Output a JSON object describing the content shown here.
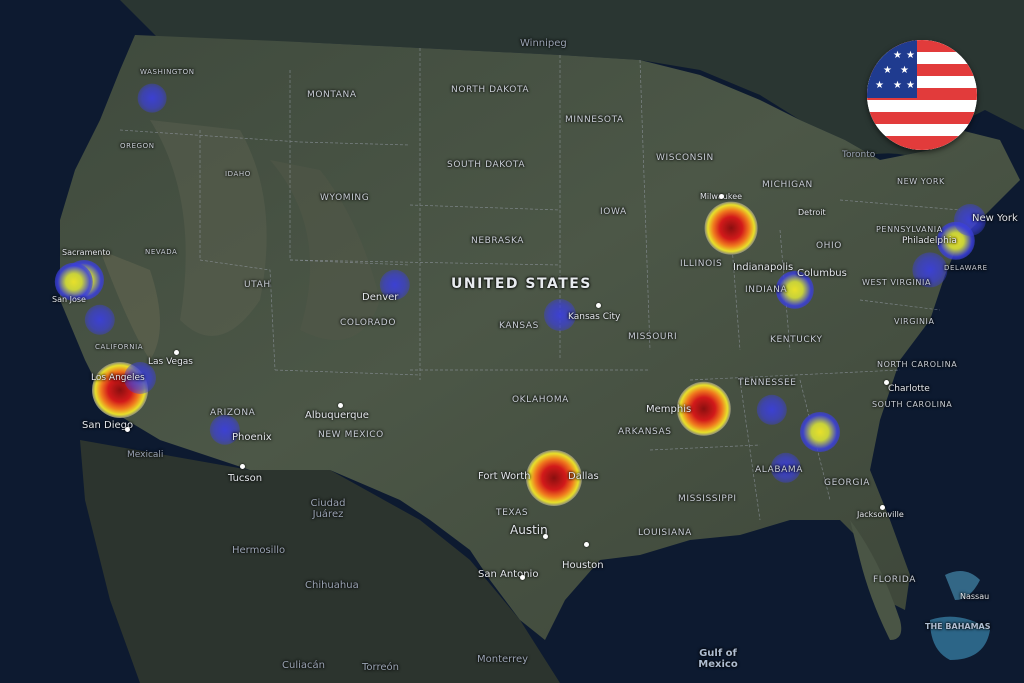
{
  "map": {
    "country_label": "UNITED STATES",
    "states": [
      "WASHINGTON",
      "MONTANA",
      "NORTH DAKOTA",
      "MINNESOTA",
      "WISCONSIN",
      "MICHIGAN",
      "OREGON",
      "IDAHO",
      "WYOMING",
      "SOUTH DAKOTA",
      "IOWA",
      "NEBRASKA",
      "NEVADA",
      "UTAH",
      "COLORADO",
      "KANSAS",
      "MISSOURI",
      "ILLINOIS",
      "INDIANA",
      "OHIO",
      "PENNSYLVANIA",
      "NEW YORK",
      "WEST VIRGINIA",
      "VIRGINIA",
      "KENTUCKY",
      "TENNESSEE",
      "NORTH CAROLINA",
      "SOUTH CAROLINA",
      "GEORGIA",
      "ALABAMA",
      "MISSISSIPPI",
      "ARKANSAS",
      "LOUISIANA",
      "OKLAHOMA",
      "TEXAS",
      "NEW MEXICO",
      "ARIZONA",
      "CALIFORNIA",
      "FLORIDA",
      "DELAWARE"
    ],
    "cities": [
      "Winnipeg",
      "Milwaukee",
      "Toronto",
      "Detroit",
      "New York",
      "Philadelphia",
      "Indianapolis",
      "Columbus",
      "Denver",
      "Kansas City",
      "Sacramento",
      "San Jose",
      "Las Vegas",
      "Los Angeles",
      "San Diego",
      "Phoenix",
      "Tucson",
      "Albuquerque",
      "Memphis",
      "Fort Worth",
      "Dallas",
      "Austin",
      "San Antonio",
      "Houston",
      "Charlotte",
      "Jacksonville",
      "Nassau",
      "Hermosillo",
      "Chihuahua",
      "Ciudad Juárez",
      "Monterrey",
      "Torreón",
      "Mexicali",
      "Culiacán"
    ],
    "water": [
      "Gulf of Mexico",
      "THE BAHAMAS"
    ],
    "flag": "united-states-flag",
    "heat_colors": {
      "low": "#3b3fdd",
      "mid": "#e8e02a",
      "high": "#d21a1a"
    },
    "heat_points": [
      {
        "name": "Seattle area",
        "intensity": 0.15
      },
      {
        "name": "Sacramento",
        "intensity": 0.5
      },
      {
        "name": "San Francisco Bay",
        "intensity": 0.45
      },
      {
        "name": "Fresno",
        "intensity": 0.2
      },
      {
        "name": "Los Angeles",
        "intensity": 1.0
      },
      {
        "name": "Las Vegas",
        "intensity": 0.25
      },
      {
        "name": "Phoenix",
        "intensity": 0.2
      },
      {
        "name": "Denver",
        "intensity": 0.2
      },
      {
        "name": "Kansas City",
        "intensity": 0.25
      },
      {
        "name": "Milwaukee",
        "intensity": 0.9
      },
      {
        "name": "Indianapolis",
        "intensity": 0.45
      },
      {
        "name": "Memphis",
        "intensity": 0.95
      },
      {
        "name": "Nashville",
        "intensity": 0.2
      },
      {
        "name": "Atlanta",
        "intensity": 0.5
      },
      {
        "name": "Birmingham",
        "intensity": 0.2
      },
      {
        "name": "Dallas",
        "intensity": 1.0
      },
      {
        "name": "Washington DC",
        "intensity": 0.35
      },
      {
        "name": "Philadelphia",
        "intensity": 0.45
      },
      {
        "name": "New York",
        "intensity": 0.25
      }
    ]
  }
}
